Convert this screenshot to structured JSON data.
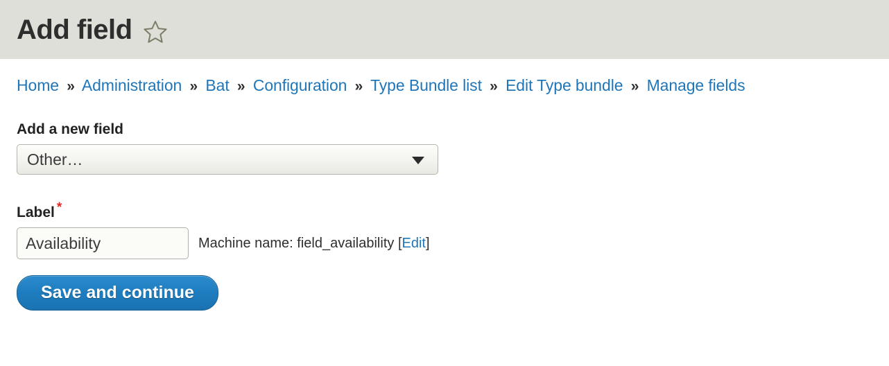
{
  "header": {
    "title": "Add field",
    "star_icon": "star-outline-icon"
  },
  "breadcrumb": {
    "separator": "»",
    "items": [
      {
        "label": "Home"
      },
      {
        "label": "Administration"
      },
      {
        "label": "Bat"
      },
      {
        "label": "Configuration"
      },
      {
        "label": "Type Bundle list"
      },
      {
        "label": "Edit Type bundle"
      },
      {
        "label": "Manage fields"
      }
    ]
  },
  "form": {
    "add_new_field": {
      "label": "Add a new field",
      "selected_option": "Other…",
      "arrow_icon": "chevron-down-icon"
    },
    "label_field": {
      "label": "Label",
      "required_mark": "*",
      "value": "Availability",
      "placeholder": "",
      "machine_name_prefix": "Machine name: field_availability",
      "machine_name_open_bracket": "[",
      "machine_name_edit_link": "Edit",
      "machine_name_close_bracket": "]"
    },
    "submit": {
      "label": "Save and continue"
    }
  },
  "colors": {
    "header_band": "#dfdfd9",
    "link": "#1f76b8",
    "required": "#e02a2a",
    "button": "#1f7ec0",
    "text": "#2e2e2e"
  }
}
